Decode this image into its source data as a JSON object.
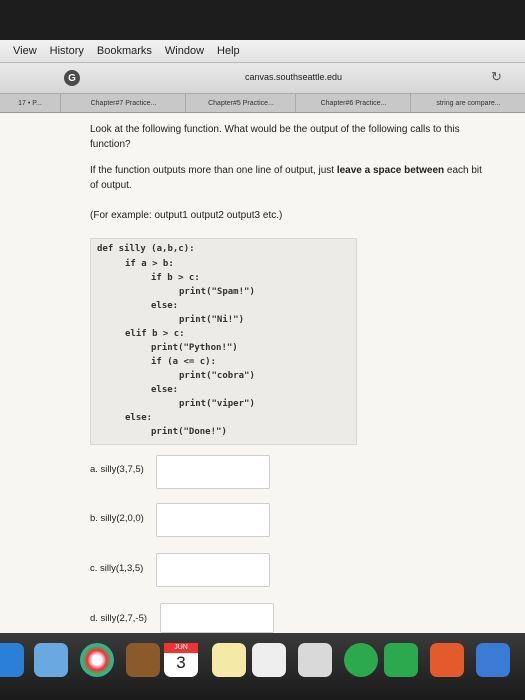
{
  "menu": [
    "View",
    "History",
    "Bookmarks",
    "Window",
    "Help"
  ],
  "toolbar": {
    "url": "canvas.southseattle.edu"
  },
  "tabs": [
    "17 • P...",
    "Chapter#7 Practice...",
    "Chapter#5 Practice...",
    "Chapter#6 Practice...",
    "string are compare..."
  ],
  "question": {
    "prompt": "Look at the following function. What would be the output of the following calls to this function?",
    "instruction_prefix": "If the function outputs more than one line of output, just ",
    "instruction_bold": "leave a space between",
    "instruction_suffix": " each bit of output.",
    "example": "(For example: output1 output2 output3 etc.)"
  },
  "code_lines": [
    "def silly (a,b,c):",
    "if a > b:",
    "if b > c:",
    "print(\"Spam!\")",
    "else:",
    "print(\"Ni!\")",
    "elif b > c:",
    "print(\"Python!\")",
    "if (a <= c):",
    "print(\"cobra\")",
    "else:",
    "print(\"viper\")",
    "else:",
    "print(\"Done!\")"
  ],
  "answers": [
    {
      "label": "a. silly(3,7,5)",
      "value": ""
    },
    {
      "label": "b. silly(2,0,0)",
      "value": ""
    },
    {
      "label": "c. silly(1,3,5)",
      "value": ""
    },
    {
      "label": "d. silly(2,7,-5)",
      "value": ""
    }
  ],
  "dock": {
    "calendar_day": "3",
    "calendar_month": "JUN"
  }
}
